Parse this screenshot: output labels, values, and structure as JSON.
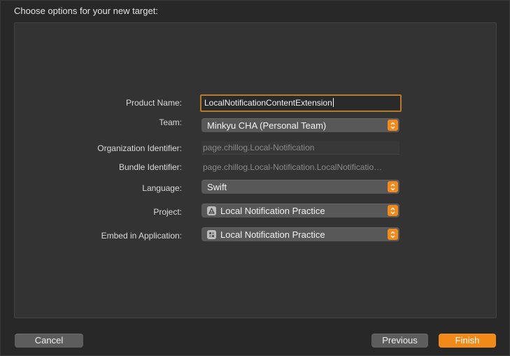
{
  "dialog": {
    "title": "Choose options for your new target:"
  },
  "form": {
    "product_name": {
      "label": "Product Name:",
      "value": "LocalNotificationContentExtension"
    },
    "team": {
      "label": "Team:",
      "value": "Minkyu CHA (Personal Team)"
    },
    "organization_identifier": {
      "label": "Organization Identifier:",
      "value": "page.chillog.Local-Notification"
    },
    "bundle_identifier": {
      "label": "Bundle Identifier:",
      "value": "page.chillog.Local-Notification.LocalNotificatio…"
    },
    "language": {
      "label": "Language:",
      "value": "Swift"
    },
    "project": {
      "label": "Project:",
      "value": "Local Notification Practice",
      "icon": "xcode-project-icon"
    },
    "embed_in_application": {
      "label": "Embed in Application:",
      "value": "Local Notification Practice",
      "icon": "app-target-icon"
    }
  },
  "buttons": {
    "cancel": "Cancel",
    "previous": "Previous",
    "finish": "Finish"
  },
  "colors": {
    "accent": "#f28a1a",
    "focus_ring": "#b67a2a",
    "background": "#282828",
    "panel": "#333333"
  }
}
